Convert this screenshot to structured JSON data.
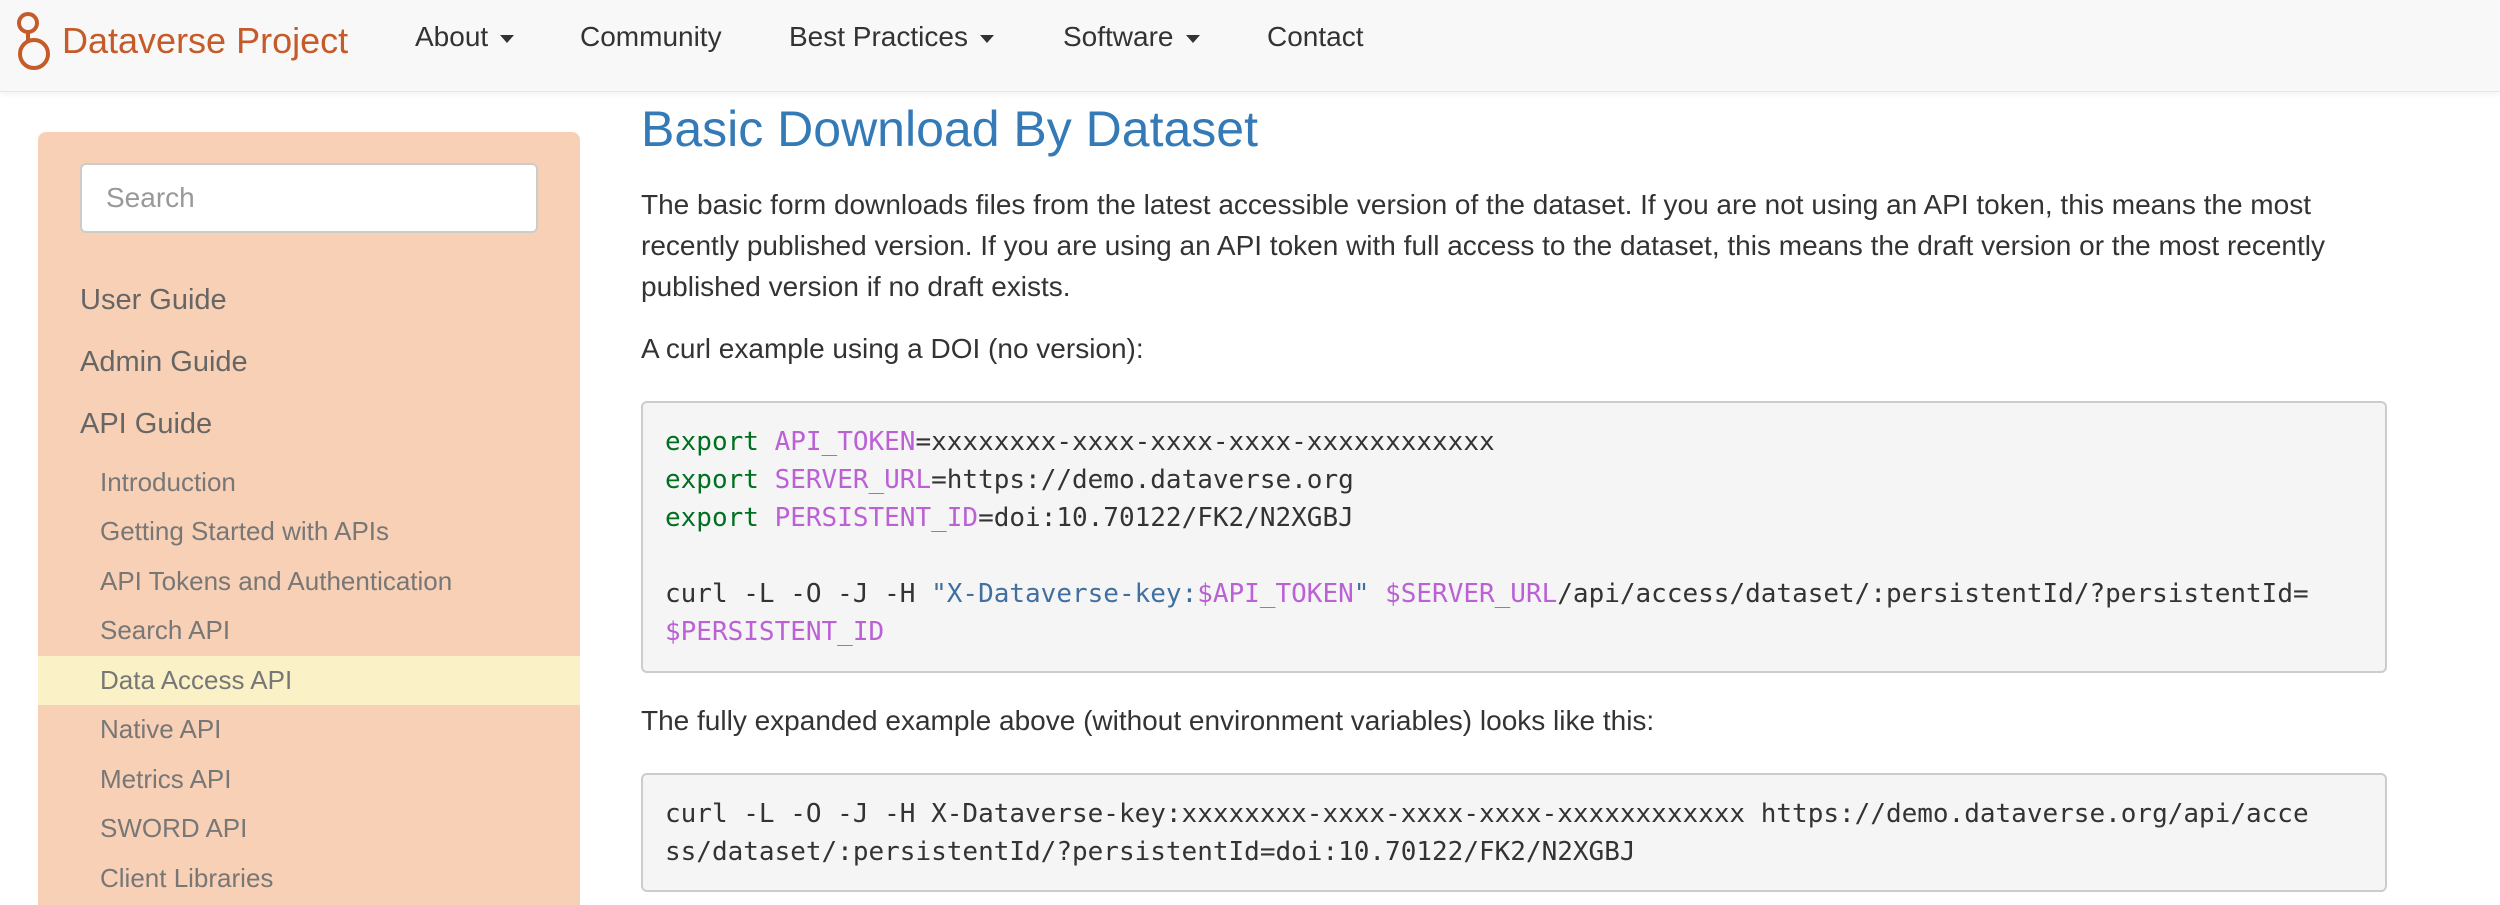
{
  "navbar": {
    "brand": "Dataverse Project",
    "items": [
      {
        "label": "About",
        "dropdown": true
      },
      {
        "label": "Community",
        "dropdown": false
      },
      {
        "label": "Best Practices",
        "dropdown": true
      },
      {
        "label": "Software",
        "dropdown": true
      },
      {
        "label": "Contact",
        "dropdown": false
      }
    ]
  },
  "sidebar": {
    "search_placeholder": "Search",
    "top_items": [
      "User Guide",
      "Admin Guide",
      "API Guide"
    ],
    "sub_items": [
      "Introduction",
      "Getting Started with APIs",
      "API Tokens and Authentication",
      "Search API",
      "Data Access API",
      "Native API",
      "Metrics API",
      "SWORD API",
      "Client Libraries"
    ],
    "active_item": "Data Access API"
  },
  "main": {
    "title": "Basic Download By Dataset",
    "intro_paragraph": "The basic form downloads files from the latest accessible version of the dataset. If you are not using an API token, this means the most recently published version. If you are using an API token with full access to the dataset, this means the draft version or the most recently published version if no draft exists.",
    "curl_example_label": "A curl example using a DOI (no version):",
    "code1": {
      "export_kw": "export",
      "api_token_var": "API_TOKEN",
      "api_token_val": "=xxxxxxxx-xxxx-xxxx-xxxx-xxxxxxxxxxxx",
      "server_url_var": "SERVER_URL",
      "server_url_val": "=https://demo.dataverse.org",
      "pid_var": "PERSISTENT_ID",
      "pid_val": "=doi:10.70122/FK2/N2XGBJ",
      "curl_cmd": "curl -L -O -J -H ",
      "header_str_open": "\"X-Dataverse-key:",
      "header_var": "$API_TOKEN",
      "header_str_close": "\"",
      "server_var": "$SERVER_URL",
      "path": "/api/access/dataset/:persistentId/?persistentId=",
      "pid_ref": "$PERSISTENT_ID"
    },
    "expanded_label": "The fully expanded example above (without environment variables) looks like this:",
    "code2": {
      "line1": "curl -L -O -J -H X-Dataverse-key:xxxxxxxx-xxxx-xxxx-xxxx-xxxxxxxxxxxx https://demo.dataverse.org/api/acce",
      "line2": "ss/dataset/:persistentId/?persistentId=doi:10.70122/FK2/N2XGBJ"
    }
  },
  "colors": {
    "brand": "#c55b28",
    "link_title": "#337ab7",
    "sidebar_bg": "#f8d0b5",
    "sidebar_active": "#faf2c6",
    "code_keyword": "#007020",
    "code_variable": "#bb60d5",
    "code_string": "#4070a0"
  }
}
